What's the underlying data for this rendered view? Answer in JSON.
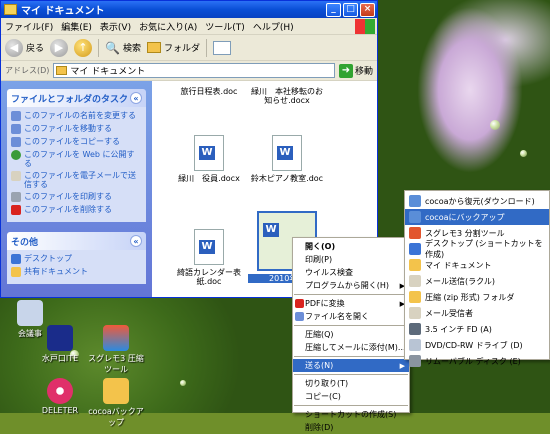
{
  "window": {
    "title": "マイ ドキュメント",
    "controls": {
      "minimize": "_",
      "maximize": "□",
      "close": "×"
    }
  },
  "menubar": [
    "ファイル(F)",
    "編集(E)",
    "表示(V)",
    "お気に入り(A)",
    "ツール(T)",
    "ヘルプ(H)"
  ],
  "toolbar": {
    "back": "戻る",
    "search": "検索",
    "folders": "フォルダ"
  },
  "address": {
    "label": "アドレス(D)",
    "value": "マイ ドキュメント",
    "go": "移動"
  },
  "taskpane": {
    "file_tasks": {
      "title": "ファイルとフォルダのタスク",
      "items": [
        "このファイルの名前を変更する",
        "このファイルを移動する",
        "このファイルをコピーする",
        "このファイルを Web に公開する",
        "このファイルを電子メールで送信する",
        "このファイルを印刷する",
        "このファイルを削除する"
      ]
    },
    "other": {
      "title": "その他",
      "items": [
        "デスクトップ",
        "共有ドキュメント"
      ]
    }
  },
  "files": [
    {
      "name": "旅行日程表.doc",
      "selected": false
    },
    {
      "name": "緑川　本社移転のお知らせ.docx",
      "selected": false
    },
    {
      "name": "緑川　役員.docx",
      "selected": false
    },
    {
      "name": "鈴木ピアノ教室.doc",
      "selected": false
    },
    {
      "name": "綺語カレンダー表紙.doc",
      "selected": false
    },
    {
      "name": "2010年...",
      "selected": true
    }
  ],
  "context_menu": {
    "items": [
      {
        "label": "開く(O)",
        "bold": true
      },
      {
        "label": "印刷(P)"
      },
      {
        "label": "ウイルス検査"
      },
      {
        "label": "プログラムから開く(H)",
        "arrow": true
      },
      {
        "sep": true
      },
      {
        "label": "PDFに変換",
        "arrow": true,
        "icon": "pdf-icon"
      },
      {
        "label": "ファイル名を開く",
        "icon": "file-icon"
      },
      {
        "sep": true
      },
      {
        "label": "圧縮(Q)"
      },
      {
        "label": "圧縮してメールに添付(M)..."
      },
      {
        "sep": true
      },
      {
        "label": "送る(N)",
        "arrow": true,
        "active": true
      },
      {
        "sep": true
      },
      {
        "label": "切り取り(T)"
      },
      {
        "label": "コピー(C)"
      },
      {
        "sep": true
      },
      {
        "label": "ショートカットの作成(S)"
      },
      {
        "label": "削除(D)"
      }
    ]
  },
  "submenu": {
    "items": [
      {
        "label": "cocoaから復元(ダウンロード)",
        "icon": "cocoa-icon"
      },
      {
        "label": "cocoaにバックアップ",
        "icon": "cocoa-icon",
        "active": true
      },
      {
        "label": "スグレモ3 分割ツール",
        "icon": "tool-icon"
      },
      {
        "label": "デスクトップ (ショートカットを作成)",
        "icon": "desktop-icon"
      },
      {
        "label": "マイ ドキュメント",
        "icon": "folder-icon"
      },
      {
        "label": "メール送信(ラクル)",
        "icon": "mail-icon"
      },
      {
        "label": "圧縮 (zip 形式) フォルダ",
        "icon": "zip-icon"
      },
      {
        "label": "メール受信者",
        "icon": "mail-icon"
      },
      {
        "label": "3.5 インチ FD (A)",
        "icon": "floppy-icon"
      },
      {
        "label": "DVD/CD-RW ドライブ (D)",
        "icon": "disc-icon"
      },
      {
        "label": "リムーバブル ディスク (E)",
        "icon": "usb-icon"
      }
    ]
  },
  "desktop_icons": [
    {
      "label": "会議事",
      "name": "desktop-icon-kaigi"
    },
    {
      "label": "水戸口ITE",
      "name": "desktop-icon-mitoguchi"
    },
    {
      "label": "スグレモ3 圧縮ツール",
      "name": "desktop-icon-suguremo"
    },
    {
      "label": "DELETER",
      "name": "desktop-icon-deleter"
    },
    {
      "label": "cocoaバックアップ",
      "name": "desktop-icon-cocoa"
    }
  ]
}
